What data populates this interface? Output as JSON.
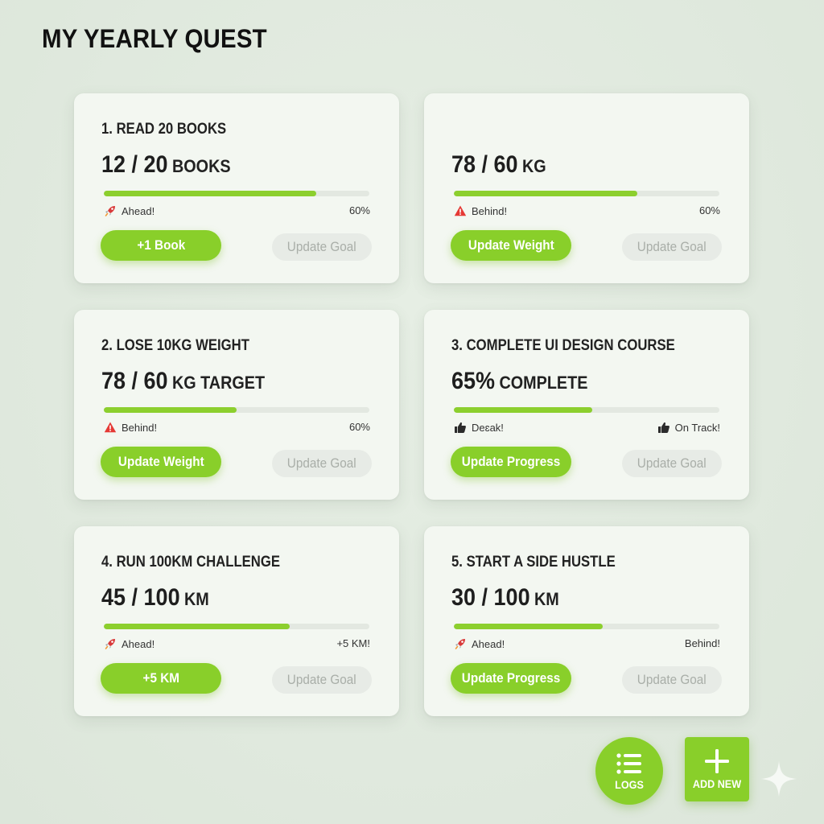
{
  "page": {
    "title": "MY YEARLY QUEST"
  },
  "colors": {
    "accent": "#89cf2a",
    "background": "#dfe8dd",
    "card": "#f3f7f1",
    "warning": "#e53935"
  },
  "cards": [
    {
      "title": "1. READ 20 BOOKS",
      "value": "12 / 20",
      "unit": "BOOKS",
      "progress": 0.8,
      "status_left": {
        "icon": "rocket-icon",
        "text": "Ahead!"
      },
      "status_right": {
        "icon": "",
        "text": "60%"
      },
      "primary_label": "+1 Book",
      "secondary_label": "Update Goal"
    },
    {
      "title": "",
      "value": "78 / 60",
      "unit": "KG",
      "progress": 0.69,
      "status_left": {
        "icon": "warning-icon",
        "text": "Behind!"
      },
      "status_right": {
        "icon": "",
        "text": "60%"
      },
      "primary_label": "Update Weight",
      "secondary_label": "Update Goal"
    },
    {
      "title": "2. LOSE 10KG WEIGHT",
      "value": "78 / 60",
      "unit": "KG TARGET",
      "progress": 0.5,
      "status_left": {
        "icon": "warning-icon",
        "text": "Behind!"
      },
      "status_right": {
        "icon": "",
        "text": "60%"
      },
      "primary_label": "Update Weight",
      "secondary_label": "Update Goal"
    },
    {
      "title": "3. COMPLETE UI DESIGN COURSE",
      "value": "65%",
      "unit": "COMPLETE",
      "progress": 0.52,
      "status_left": {
        "icon": "thumbs-up-icon",
        "text": "Deɛak!"
      },
      "status_right": {
        "icon": "thumbs-up-icon",
        "text": "On Track!"
      },
      "primary_label": "Update Progress",
      "secondary_label": "Update Goal"
    },
    {
      "title": "4. RUN 100KM CHALLENGE",
      "value": "45 / 100",
      "unit": "KM",
      "progress": 0.7,
      "status_left": {
        "icon": "rocket-icon",
        "text": "Ahead!"
      },
      "status_right": {
        "icon": "",
        "text": "+5 KM!"
      },
      "primary_label": "+5 KM",
      "secondary_label": "Update Goal"
    },
    {
      "title": "5. START A SIDE HUSTLE",
      "value": "30 / 100",
      "unit": "KM",
      "progress": 0.56,
      "status_left": {
        "icon": "rocket-icon",
        "text": "Ahead!"
      },
      "status_right": {
        "icon": "",
        "text": "Behind!"
      },
      "primary_label": "Update Progress",
      "secondary_label": "Update Goal"
    }
  ],
  "fab": {
    "logs_label": "LOGS",
    "logs_icon": "list-icon",
    "add_label": "ADD NEW",
    "add_icon": "plus-icon"
  },
  "decoration": {
    "sparkle_icon": "sparkle-icon"
  }
}
